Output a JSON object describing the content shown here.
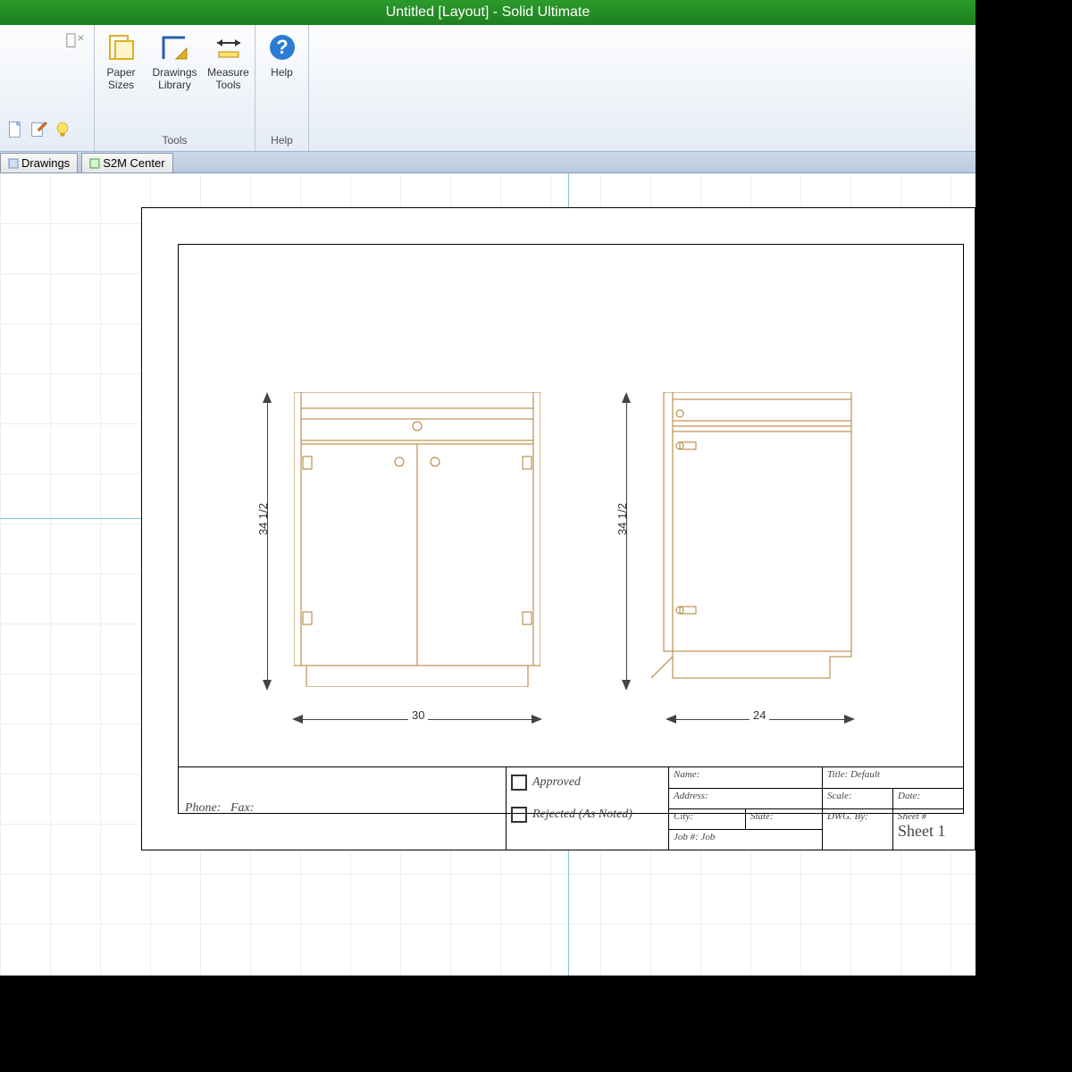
{
  "window": {
    "title": "Untitled [Layout] - Solid Ultimate"
  },
  "ribbon": {
    "paperSizes": {
      "line1": "Paper",
      "line2": "Sizes"
    },
    "drawingsLibrary": {
      "line1": "Drawings",
      "line2": "Library"
    },
    "measureTools": {
      "line1": "Measure",
      "line2": "Tools"
    },
    "groupTools": "Tools",
    "help": "Help",
    "groupHelp": "Help"
  },
  "tabs": {
    "drawings": "Drawings",
    "s2m": "S2M Center"
  },
  "dims": {
    "height": "34 1/2",
    "front_width": "30",
    "side_width": "24"
  },
  "titleblock": {
    "phone": "Phone:",
    "fax": "Fax:",
    "approved": "Approved",
    "rejected": "Rejected (As Noted)",
    "name": "Name:",
    "address": "Address:",
    "city": "City:",
    "state": "State:",
    "job": "Job #: Job",
    "title": "Title: Default",
    "scale": "Scale:",
    "date": "Date:",
    "dwgby": "DWG. By:",
    "sheetnum_lbl": "Sheet #",
    "sheetnum": "Sheet 1"
  }
}
